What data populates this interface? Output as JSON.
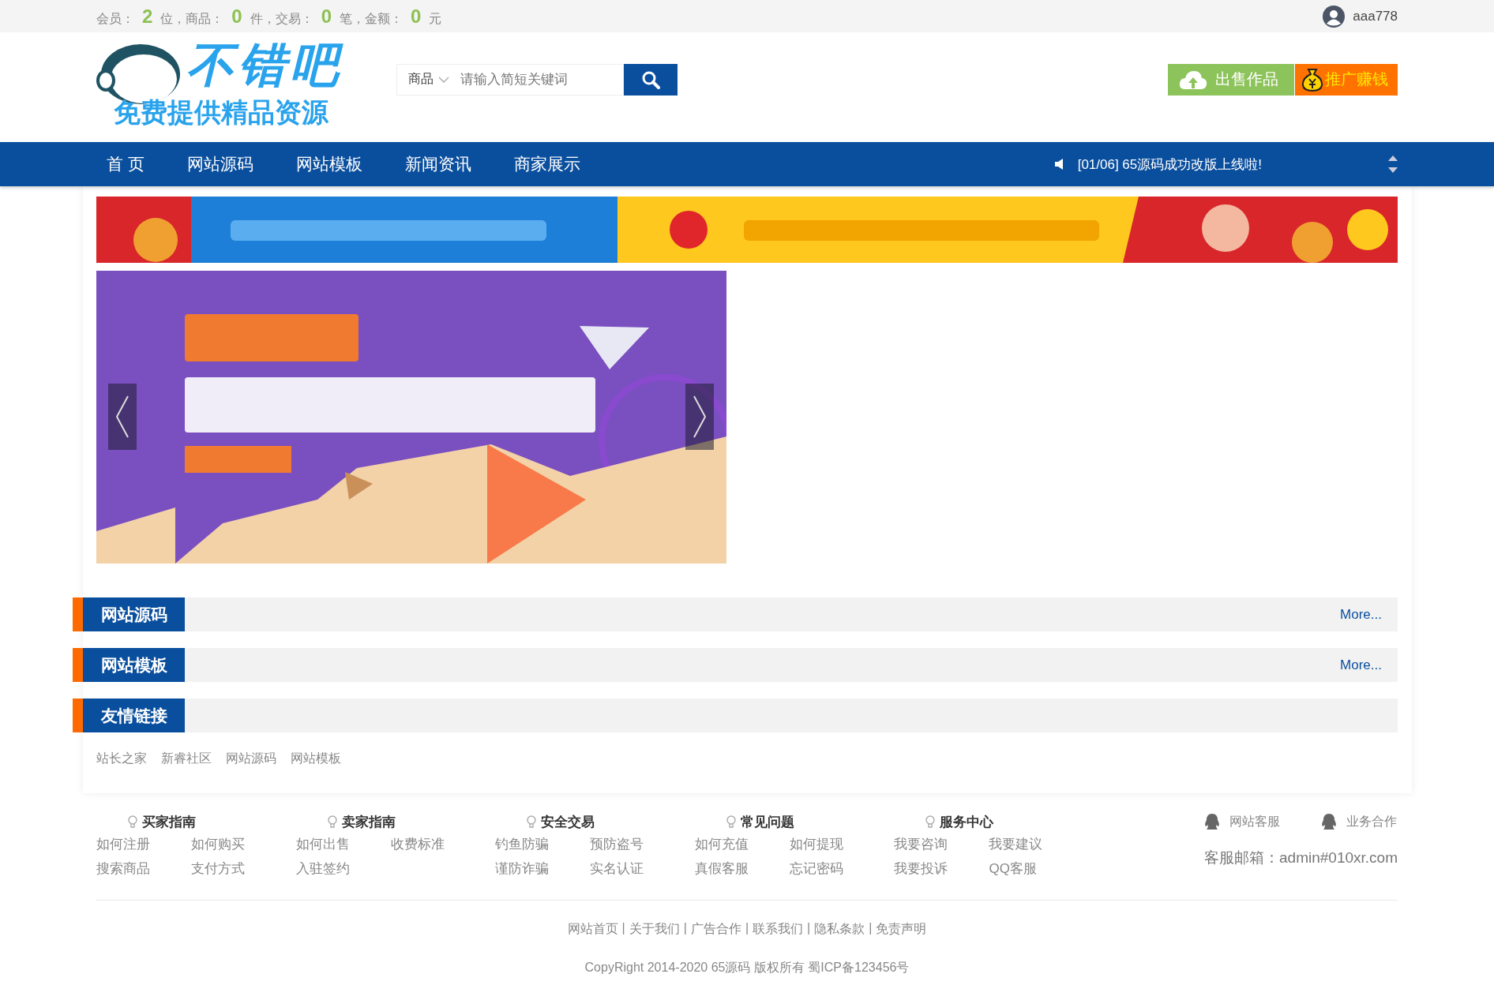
{
  "top_bar": {
    "stats": [
      {
        "label": "会员：",
        "value": "2",
        "unit": "位，"
      },
      {
        "label": "商品：",
        "value": "0",
        "unit": "件，"
      },
      {
        "label": "交易：",
        "value": "0",
        "unit": "笔，"
      },
      {
        "label": "金额：",
        "value": "0",
        "unit": "元"
      }
    ],
    "user": "aaa778"
  },
  "header": {
    "logo_title": "不错吧",
    "logo_tagline": "免费提供精品资源",
    "search": {
      "category": "商品",
      "placeholder": "请输入简短关键词"
    },
    "buttons": [
      {
        "label": "出售作品",
        "kind": "sell"
      },
      {
        "label": "推广赚钱",
        "kind": "promote"
      }
    ]
  },
  "nav": {
    "items": [
      "首 页",
      "网站源码",
      "网站模板",
      "新闻资讯",
      "商家展示"
    ],
    "notice": "[01/06] 65源码成功改版上线啦!"
  },
  "sections": [
    {
      "title": "网站源码",
      "more": "More..."
    },
    {
      "title": "网站模板",
      "more": "More..."
    },
    {
      "title": "友情链接"
    }
  ],
  "friend_links": [
    "站长之家",
    "新睿社区",
    "网站源码",
    "网站模板"
  ],
  "footer": {
    "groups": [
      {
        "title": "买家指南",
        "links": [
          "如何注册",
          "如何购买",
          "搜索商品",
          "支付方式"
        ]
      },
      {
        "title": "卖家指南",
        "links": [
          "如何出售",
          "收费标准",
          "入驻签约"
        ]
      },
      {
        "title": "安全交易",
        "links": [
          "钓鱼防骗",
          "预防盗号",
          "谨防诈骗",
          "实名认证"
        ]
      },
      {
        "title": "常见问题",
        "links": [
          "如何充值",
          "如何提现",
          "真假客服",
          "忘记密码"
        ]
      },
      {
        "title": "服务中心",
        "links": [
          "我要咨询",
          "我要建议",
          "我要投诉",
          "QQ客服"
        ]
      }
    ],
    "contacts": [
      "网站客服",
      "业务合作"
    ],
    "email": "客服邮箱：admin#010xr.com",
    "bottom_links": [
      "网站首页",
      "关于我们",
      "广告合作",
      "联系我们",
      "隐私条款",
      "免责声明"
    ],
    "separator": "|",
    "copyright": "CopyRight 2014-2020 65源码 版权所有 蜀ICP备123456号"
  }
}
